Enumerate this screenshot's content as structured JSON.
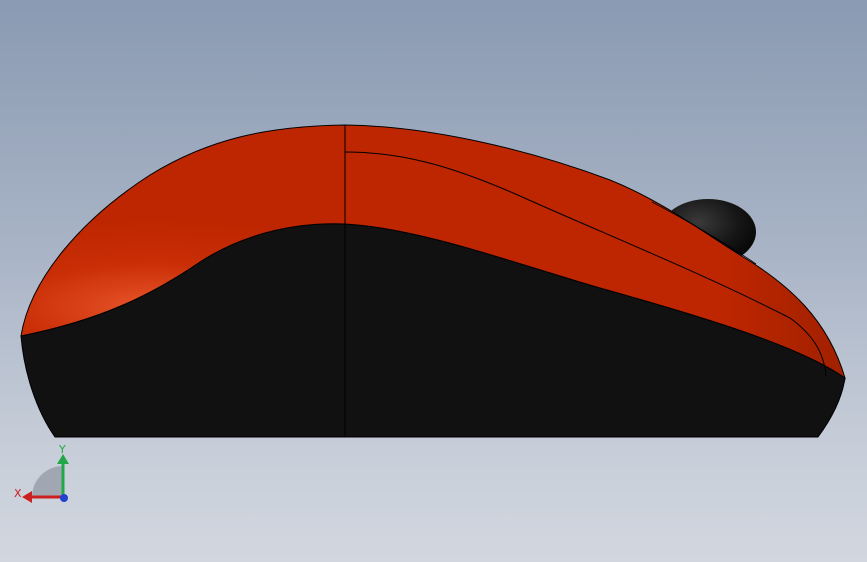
{
  "viewport": {
    "background_top": "#8a9ab2",
    "background_bottom": "#d2d7df"
  },
  "model": {
    "shell_color": "#c02800",
    "base_color": "#111111",
    "wheel_color": "#141414",
    "edge_color": "#000000"
  },
  "triad": {
    "y_label": "Y",
    "x_label": "X",
    "y_color": "#22a64a",
    "x_color": "#cc2020",
    "z_color": "#2040d0"
  }
}
